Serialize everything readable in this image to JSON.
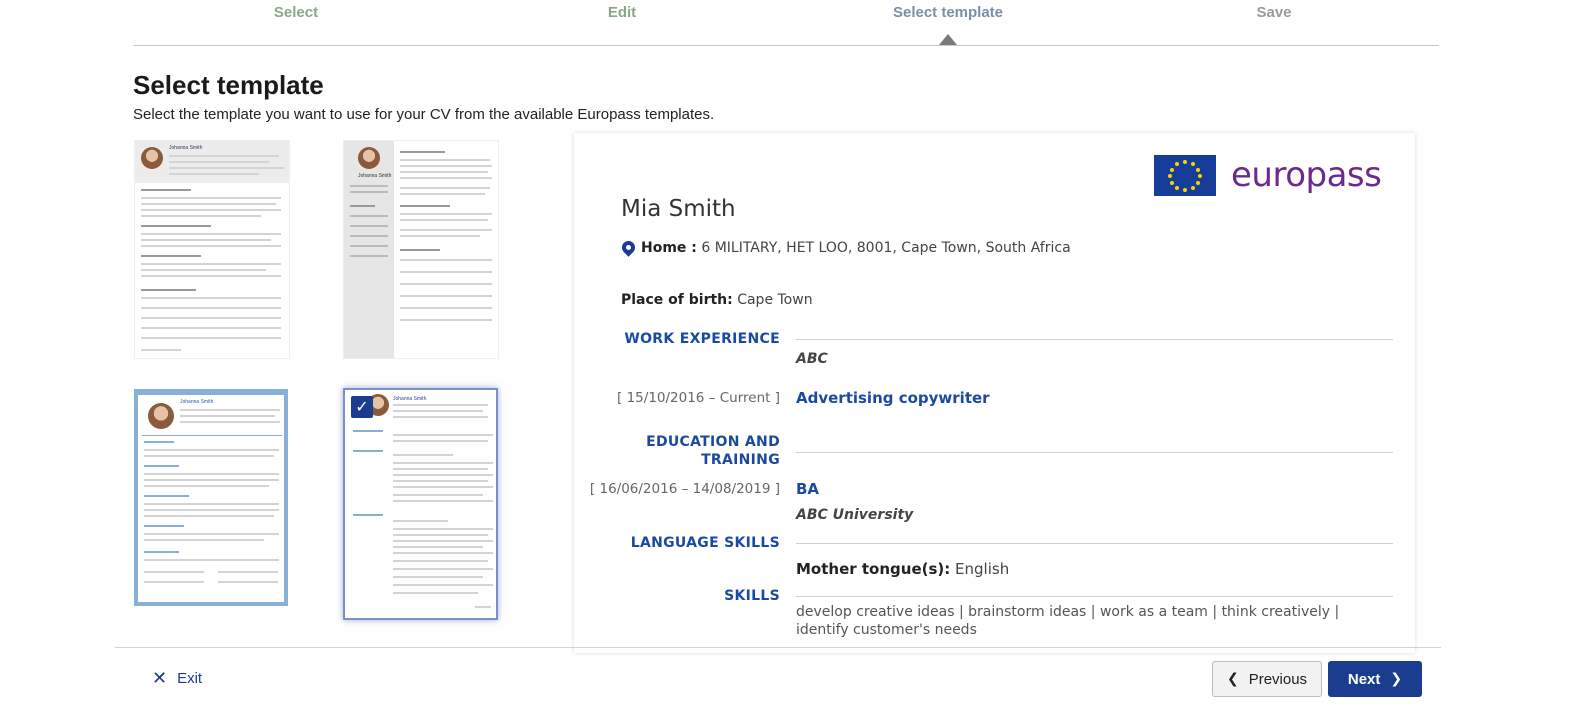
{
  "stepper": {
    "steps": [
      {
        "label": "Select",
        "state": "done"
      },
      {
        "label": "Edit",
        "state": "done"
      },
      {
        "label": "Select template",
        "state": "active"
      },
      {
        "label": "Save",
        "state": "todo"
      }
    ]
  },
  "page": {
    "title": "Select template",
    "subtitle": "Select the template you want to use for your CV from the available Europass templates."
  },
  "templates": {
    "thumb1_name": "Johanna Smith",
    "thumb2_name": "Johanna Smith",
    "thumb3_name": "Johanna Smith",
    "thumb4_name": "Johanna Smith",
    "selected_index": 4,
    "check_icon": "check-icon"
  },
  "preview": {
    "logo_text": "europass",
    "name": "Mia Smith",
    "home_label": "Home :",
    "home_value": "6 MILITARY, HET LOO, 8001, Cape Town, South Africa",
    "birth_label": "Place of birth:",
    "birth_value": "Cape Town",
    "work_heading": "WORK EXPERIENCE",
    "work_org": "ABC",
    "work_date": "[ 15/10/2016 – Current ]",
    "work_title": "Advertising copywriter",
    "edu_heading_line1": "EDUCATION AND",
    "edu_heading_line2": "TRAINING",
    "edu_date": "[ 16/06/2016 – 14/08/2019 ]",
    "edu_title": "BA",
    "edu_org": "ABC University",
    "lang_heading": "LANGUAGE SKILLS",
    "mother_label": "Mother tongue(s):",
    "mother_value": "English",
    "skills_heading": "SKILLS",
    "skills_text": "develop creative ideas |  brainstorm ideas |  work as a team |  think creatively |  identify customer's needs"
  },
  "footer": {
    "exit_label": "Exit",
    "previous_label": "Previous",
    "next_label": "Next"
  },
  "colors": {
    "brand_blue": "#1a3d8f",
    "section_blue": "#1a4aa0",
    "europass_purple": "#6b2a8c"
  }
}
